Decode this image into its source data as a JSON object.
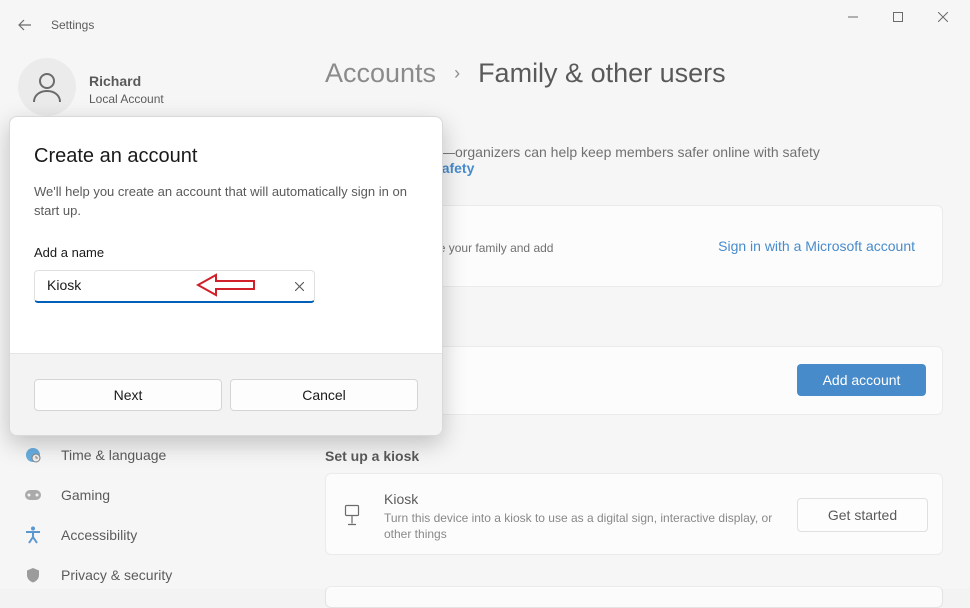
{
  "app": {
    "title": "Settings"
  },
  "colors": {
    "accent": "#005fb8",
    "annotation_arrow": "#d0202a"
  },
  "profile": {
    "name": "Richard",
    "subtitle": "Local Account"
  },
  "nav": {
    "items": [
      {
        "label": "Time & language",
        "icon": "globe-clock-icon"
      },
      {
        "label": "Gaming",
        "icon": "gamepad-icon"
      },
      {
        "label": "Accessibility",
        "icon": "accessibility-icon"
      },
      {
        "label": "Privacy & security",
        "icon": "shield-icon"
      }
    ]
  },
  "breadcrumb": {
    "parent": "Accounts",
    "separator": "›",
    "current": "Family & other users"
  },
  "main": {
    "description": "s sign in to this PC—organizers can help keep members safer online with safety",
    "description_link": "re about Family Safety",
    "ms_card_text": "osoft account to see your family and add",
    "ms_card_link": "Sign in with a Microsoft account",
    "add_account_button": "Add account",
    "kiosk_section_title": "Set up a kiosk",
    "kiosk_title": "Kiosk",
    "kiosk_desc": "Turn this device into a kiosk to use as a digital sign, interactive display, or other things",
    "get_started_button": "Get started"
  },
  "dialog": {
    "title": "Create an account",
    "text": "We'll help you create an account that will automatically sign in on start up.",
    "name_label": "Add a name",
    "name_value": "Kiosk",
    "next_button": "Next",
    "cancel_button": "Cancel"
  }
}
